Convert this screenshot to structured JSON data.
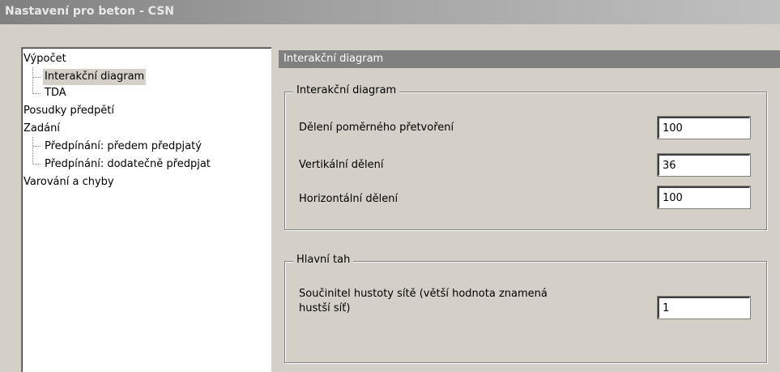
{
  "window": {
    "title": "Nastavení pro beton - CSN"
  },
  "tree": {
    "items": [
      {
        "label": "Výpočet"
      },
      {
        "label": "Interakční diagram"
      },
      {
        "label": "TDA"
      },
      {
        "label": "Posudky předpětí"
      },
      {
        "label": "Zadání"
      },
      {
        "label": "Předpínání: předem předpjatý"
      },
      {
        "label": "Předpínání: dodatečně předpjat"
      },
      {
        "label": "Varování a chyby"
      }
    ]
  },
  "panel": {
    "header": "Interakční diagram",
    "group1": {
      "title": "Interakční diagram",
      "rows": [
        {
          "label": "Dělení poměrného přetvoření",
          "value": "100"
        },
        {
          "label": "Vertikální dělení",
          "value": "36"
        },
        {
          "label": "Horizontální dělení",
          "value": "100"
        }
      ]
    },
    "group2": {
      "title": "Hlavní tah",
      "rows": [
        {
          "label_line1": "Součinitel hustoty sítě (větší hodnota znamená",
          "label_line2": "hustší síť)",
          "value": "1"
        }
      ]
    }
  }
}
